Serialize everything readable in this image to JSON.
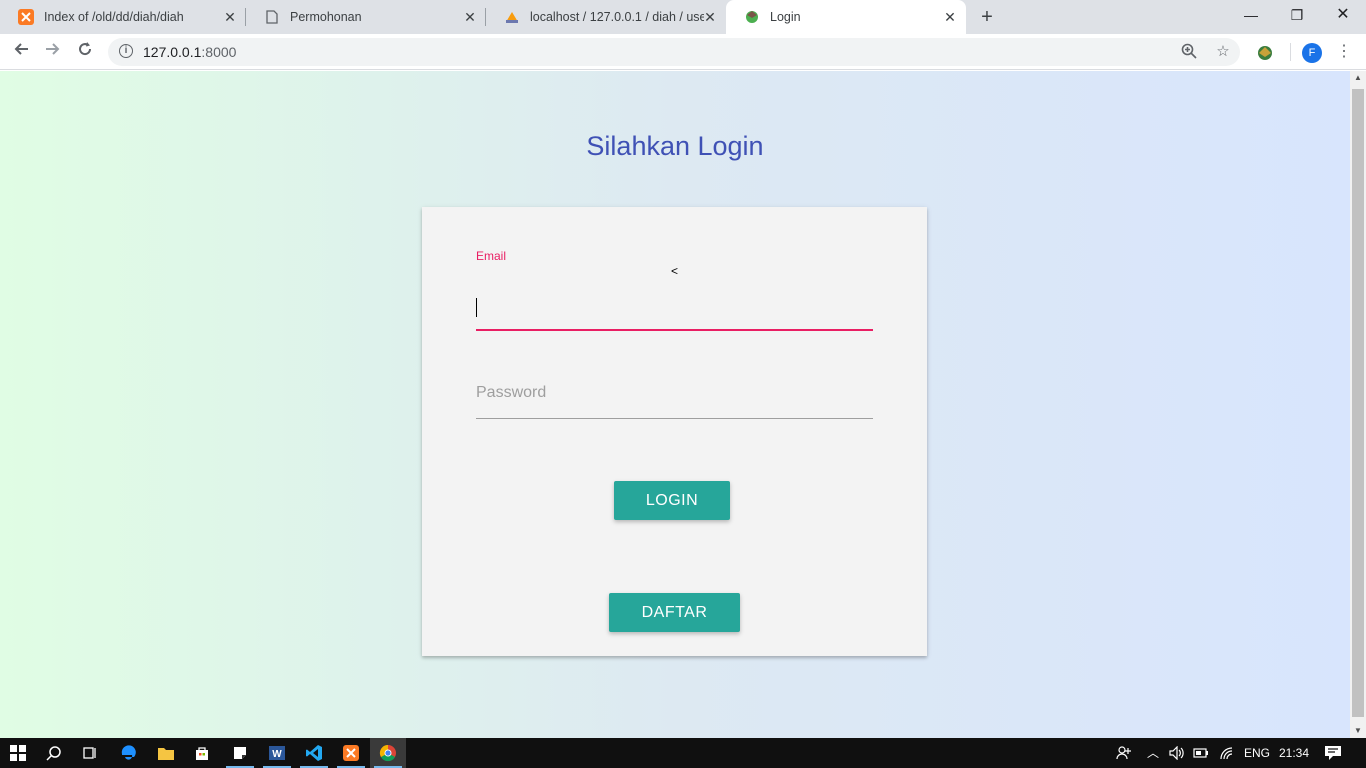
{
  "browser": {
    "tabs": [
      {
        "title": "Index of /old/dd/diah/diah",
        "icon": "xampp-icon"
      },
      {
        "title": "Permohonan",
        "icon": "page-icon"
      },
      {
        "title": "localhost / 127.0.0.1 / diah / user",
        "icon": "phpmyadmin-icon"
      },
      {
        "title": "Login",
        "icon": "site-icon",
        "active": true
      }
    ],
    "new_tab": "+",
    "url_host": "127.0.0.1",
    "url_port": ":8000",
    "profile_initial": "F"
  },
  "page": {
    "title": "Silahkan Login",
    "email_label": "Email",
    "stray_text": "<",
    "email_value": "",
    "password_label": "Password",
    "login_button": "LOGIN",
    "register_button": "DAFTAR"
  },
  "colors": {
    "title": "#3f51b5",
    "focus": "#e91e63",
    "button": "#26a69a"
  },
  "taskbar": {
    "language": "ENG",
    "time": "21:34"
  }
}
